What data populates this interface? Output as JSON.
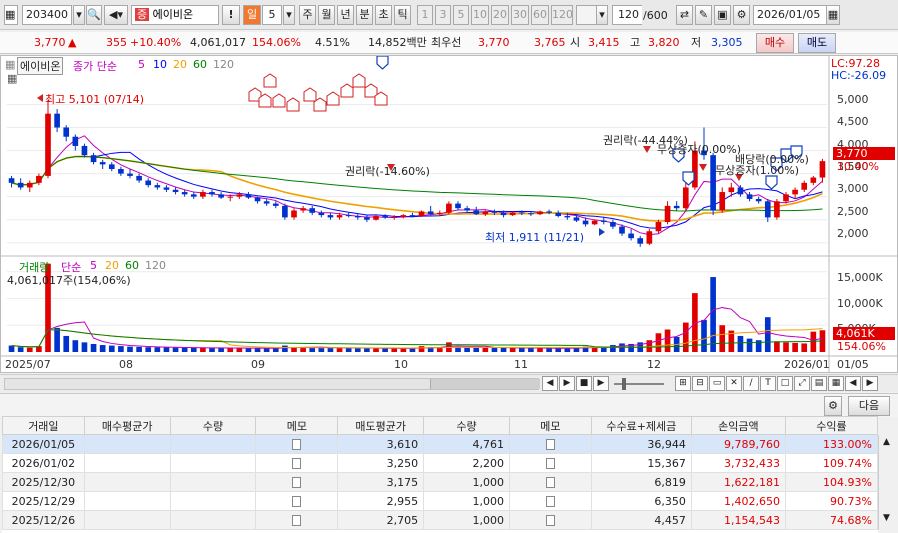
{
  "toolbar": {
    "code": "203400",
    "stock_name": "에이비온",
    "stock_tag": "증",
    "period_badge": "일",
    "period_value": "5",
    "period_buttons": [
      "주",
      "월",
      "년",
      "분",
      "초",
      "틱"
    ],
    "interval_buttons": [
      "1",
      "3",
      "5",
      "10",
      "20",
      "30",
      "60",
      "120"
    ],
    "count": "120",
    "count_total": "/600",
    "date": "2026/01/05"
  },
  "quote": {
    "price": "3,770",
    "arrow": "▲",
    "change": "355",
    "change_pct": "+10.40%",
    "volume": "4,061,017",
    "volume_ratio": "154.06%",
    "turnover": "4.51%",
    "amount": "14,852백만",
    "best_sell_label": "최우선",
    "best_ask": "3,770",
    "best_bid": "3,765",
    "open_label": "시",
    "open": "3,415",
    "high_label": "고",
    "high": "3,820",
    "low_label": "저",
    "low": "3,305",
    "buy_btn": "매수",
    "sell_btn": "매도"
  },
  "chart": {
    "name_tag": "에이비온",
    "ma_label": "종가 단순",
    "ma_periods": [
      "5",
      "10",
      "20",
      "60",
      "120"
    ],
    "lc": "LC:97.28",
    "hc": "HC:-26.09",
    "high_note": "최고 5,101 (07/14)",
    "low_note": "최저 1,911 (11/21)",
    "event_1": "권리락(-14.60%)",
    "event_2": "권리락(-44.44%)",
    "event_3": "무상증자(0.00%)",
    "event_4": "배당락(0.00%)",
    "event_5": "무상증자(1.00%)",
    "price_ticks": [
      "5,000",
      "4,500",
      "4,000",
      "3,500",
      "3,000",
      "2,500",
      "2,000"
    ],
    "last_price_tag": "3,770",
    "last_pct_tag": "10.40%",
    "vol_title": "거래량",
    "vol_ma_label": "단순",
    "vol_periods": [
      "5",
      "20",
      "60",
      "120"
    ],
    "vol_note": "4,061,017주(154,06%)",
    "vol_ticks": [
      "15,000K",
      "10,000K",
      "5,000K"
    ],
    "vol_tag": "4,061K",
    "vol_pct_tag": "154.06%",
    "x_labels": [
      "2025/07",
      "08",
      "09",
      "10",
      "11",
      "12",
      "2026/01",
      "01/05"
    ]
  },
  "chart_data": {
    "type": "candlestick",
    "price_ylim": [
      1800,
      5400
    ],
    "volume_ylim": [
      0,
      17000
    ],
    "candles": [
      [
        3400,
        3450,
        3200,
        3300
      ],
      [
        3300,
        3400,
        3150,
        3200
      ],
      [
        3200,
        3350,
        3100,
        3300
      ],
      [
        3300,
        3500,
        3250,
        3450
      ],
      [
        3450,
        5101,
        3400,
        4800
      ],
      [
        4800,
        4900,
        4400,
        4500
      ],
      [
        4500,
        4550,
        4200,
        4300
      ],
      [
        4300,
        4350,
        4000,
        4100
      ],
      [
        4100,
        4150,
        3850,
        3900
      ],
      [
        3900,
        3950,
        3700,
        3750
      ],
      [
        3750,
        3800,
        3600,
        3700
      ],
      [
        3700,
        3750,
        3550,
        3600
      ],
      [
        3600,
        3650,
        3450,
        3500
      ],
      [
        3500,
        3600,
        3400,
        3450
      ],
      [
        3450,
        3500,
        3300,
        3350
      ],
      [
        3350,
        3400,
        3200,
        3250
      ],
      [
        3250,
        3300,
        3150,
        3200
      ],
      [
        3200,
        3250,
        3100,
        3150
      ],
      [
        3150,
        3200,
        3050,
        3100
      ],
      [
        3100,
        3150,
        3000,
        3050
      ],
      [
        3050,
        3100,
        2950,
        3000
      ],
      [
        3000,
        3150,
        2950,
        3100
      ],
      [
        3100,
        3150,
        3000,
        3050
      ],
      [
        3050,
        3100,
        2950,
        2980
      ],
      [
        2980,
        3050,
        2900,
        3000
      ],
      [
        3000,
        3100,
        2950,
        3050
      ],
      [
        3050,
        3100,
        2950,
        2980
      ],
      [
        2980,
        3000,
        2850,
        2900
      ],
      [
        2900,
        2950,
        2800,
        2850
      ],
      [
        2850,
        2900,
        2750,
        2800
      ],
      [
        2800,
        2850,
        2500,
        2550
      ],
      [
        2550,
        2750,
        2500,
        2700
      ],
      [
        2700,
        2800,
        2650,
        2750
      ],
      [
        2750,
        2800,
        2600,
        2650
      ],
      [
        2650,
        2700,
        2550,
        2600
      ],
      [
        2600,
        2650,
        2500,
        2550
      ],
      [
        2550,
        2650,
        2500,
        2600
      ],
      [
        2600,
        2650,
        2550,
        2580
      ],
      [
        2580,
        2620,
        2500,
        2550
      ],
      [
        2550,
        2600,
        2450,
        2500
      ],
      [
        2500,
        2600,
        2480,
        2580
      ],
      [
        2580,
        2620,
        2520,
        2550
      ],
      [
        2550,
        2600,
        2500,
        2560
      ],
      [
        2560,
        2620,
        2530,
        2600
      ],
      [
        2600,
        2650,
        2550,
        2580
      ],
      [
        2580,
        2700,
        2560,
        2680
      ],
      [
        2680,
        2800,
        2600,
        2620
      ],
      [
        2620,
        2700,
        2580,
        2650
      ],
      [
        2650,
        2900,
        2620,
        2850
      ],
      [
        2850,
        2900,
        2700,
        2750
      ],
      [
        2750,
        2800,
        2650,
        2700
      ],
      [
        2700,
        2780,
        2600,
        2620
      ],
      [
        2620,
        2700,
        2580,
        2680
      ],
      [
        2680,
        2720,
        2600,
        2650
      ],
      [
        2650,
        2700,
        2550,
        2600
      ],
      [
        2600,
        2680,
        2580,
        2660
      ],
      [
        2660,
        2700,
        2600,
        2640
      ],
      [
        2640,
        2680,
        2580,
        2620
      ],
      [
        2620,
        2700,
        2600,
        2680
      ],
      [
        2680,
        2720,
        2620,
        2650
      ],
      [
        2650,
        2700,
        2550,
        2580
      ],
      [
        2580,
        2650,
        2500,
        2550
      ],
      [
        2550,
        2600,
        2450,
        2480
      ],
      [
        2480,
        2550,
        2350,
        2400
      ],
      [
        2400,
        2500,
        2380,
        2480
      ],
      [
        2480,
        2550,
        2400,
        2450
      ],
      [
        2450,
        2500,
        2300,
        2350
      ],
      [
        2350,
        2400,
        2150,
        2200
      ],
      [
        2200,
        2300,
        2050,
        2100
      ],
      [
        2100,
        2150,
        1911,
        1980
      ],
      [
        1980,
        2300,
        1950,
        2250
      ],
      [
        2250,
        2500,
        2200,
        2450
      ],
      [
        2450,
        2900,
        2400,
        2800
      ],
      [
        2800,
        2900,
        2700,
        2750
      ],
      [
        2750,
        3300,
        2700,
        3200
      ],
      [
        3200,
        4200,
        3150,
        4000
      ],
      [
        4000,
        4500,
        3800,
        3900
      ],
      [
        3900,
        3950,
        2600,
        2700
      ],
      [
        2700,
        3200,
        2650,
        3100
      ],
      [
        3100,
        3300,
        3000,
        3200
      ],
      [
        3200,
        3250,
        3000,
        3050
      ],
      [
        3050,
        3100,
        2900,
        2950
      ],
      [
        2950,
        3000,
        2850,
        2900
      ],
      [
        2900,
        2950,
        2450,
        2550
      ],
      [
        2550,
        2950,
        2500,
        2900
      ],
      [
        2900,
        3100,
        2850,
        3050
      ],
      [
        3050,
        3200,
        2950,
        3150
      ],
      [
        3150,
        3350,
        3100,
        3300
      ],
      [
        3300,
        3450,
        3250,
        3415
      ],
      [
        3415,
        3820,
        3305,
        3770
      ]
    ],
    "volumes": [
      1200,
      900,
      800,
      1100,
      16500,
      4500,
      3000,
      2200,
      1800,
      1500,
      1300,
      1200,
      1100,
      1000,
      950,
      900,
      880,
      850,
      820,
      800,
      780,
      760,
      750,
      740,
      730,
      720,
      700,
      690,
      680,
      670,
      1200,
      900,
      850,
      820,
      800,
      780,
      760,
      740,
      720,
      700,
      690,
      680,
      670,
      660,
      650,
      1100,
      900,
      850,
      1800,
      950,
      900,
      850,
      820,
      800,
      780,
      760,
      740,
      720,
      700,
      690,
      680,
      670,
      900,
      1000,
      850,
      800,
      1300,
      1600,
      1500,
      1800,
      2200,
      3500,
      4200,
      2800,
      5500,
      11000,
      6000,
      14000,
      5000,
      4000,
      3000,
      2500,
      2200,
      6500,
      2000,
      1800,
      1700,
      1600,
      3800,
      4061
    ]
  },
  "controls": {
    "buttons": [
      "◀",
      "▶",
      "■",
      "▶",
      "◀"
    ]
  },
  "table": {
    "next_btn": "다음",
    "headers": [
      "거래일",
      "매수평균가",
      "수량",
      "메모",
      "매도평균가",
      "수량",
      "메모",
      "수수료+제세금",
      "손익금액",
      "수익률"
    ],
    "rows": [
      [
        "2026/01/05",
        "",
        "",
        "",
        "3,610",
        "4,761",
        "",
        "36,944",
        "9,789,760",
        "133.00%"
      ],
      [
        "2026/01/02",
        "",
        "",
        "",
        "3,250",
        "2,200",
        "",
        "15,367",
        "3,732,433",
        "109.74%"
      ],
      [
        "2025/12/30",
        "",
        "",
        "",
        "3,175",
        "1,000",
        "",
        "6,819",
        "1,622,181",
        "104.93%"
      ],
      [
        "2025/12/29",
        "",
        "",
        "",
        "2,955",
        "1,000",
        "",
        "6,350",
        "1,402,650",
        "90.73%"
      ],
      [
        "2025/12/26",
        "",
        "",
        "",
        "2,705",
        "1,000",
        "",
        "4,457",
        "1,154,543",
        "74.68%"
      ]
    ]
  },
  "colors": {
    "up": "#e00000",
    "down": "#0033cc",
    "ma5": "#c000c0",
    "ma10": "#0000ff",
    "ma20": "#f0a000",
    "ma60": "#008000",
    "ma120": "#888888"
  }
}
